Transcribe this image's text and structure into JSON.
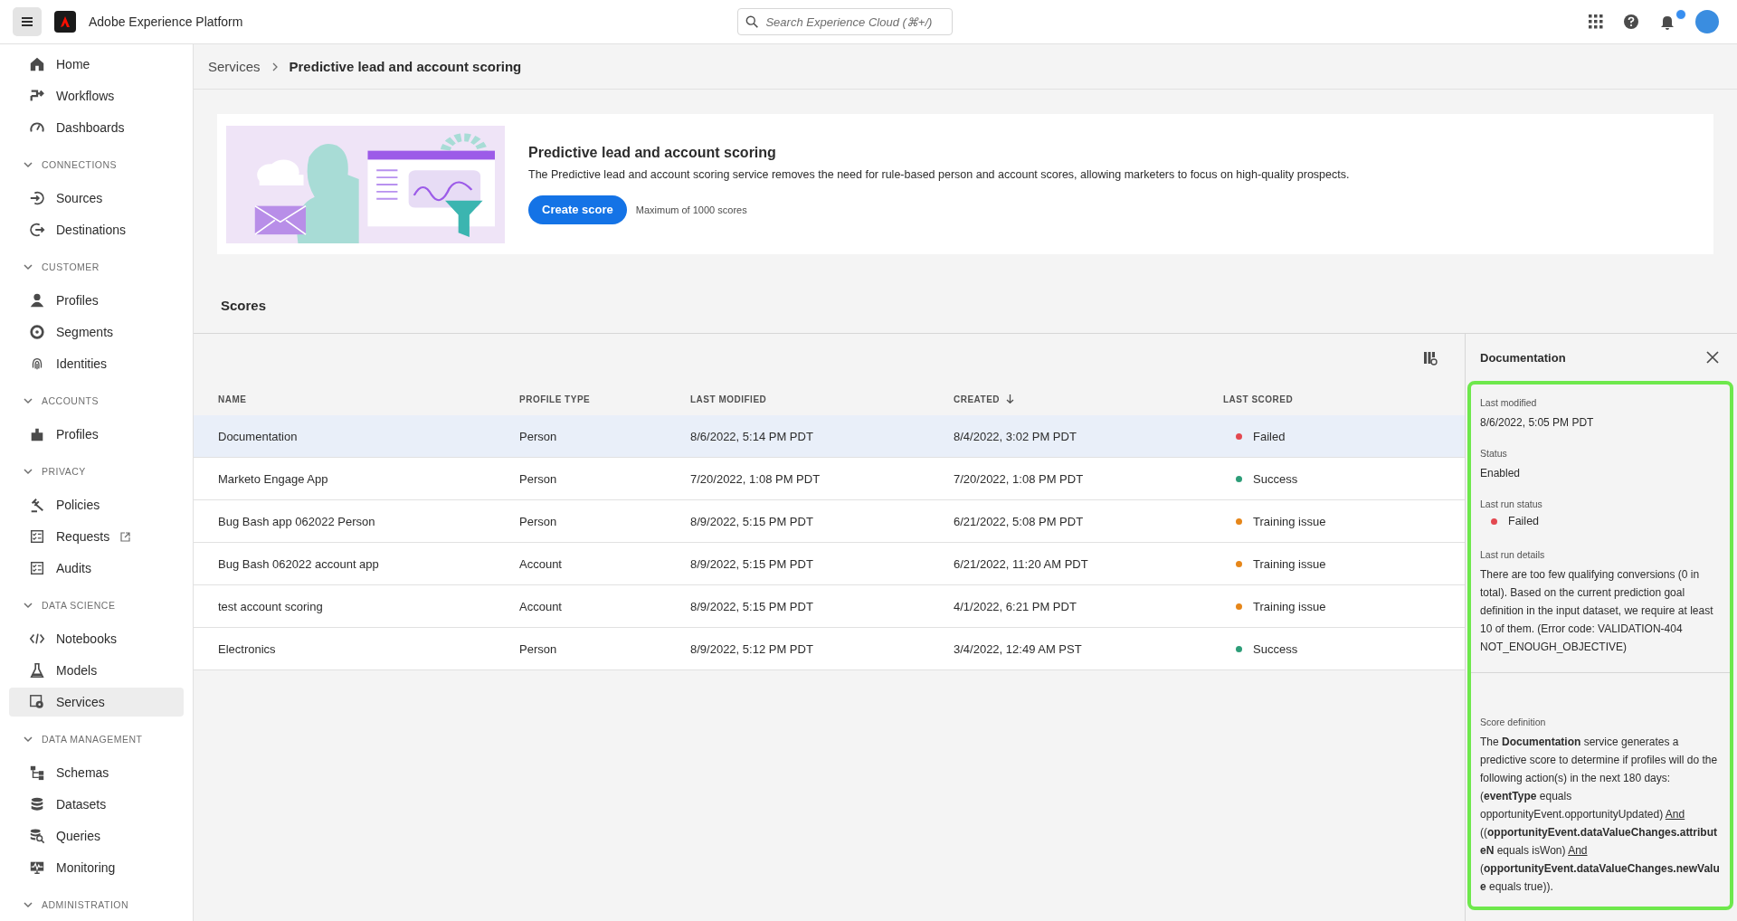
{
  "top_bar": {
    "product": "Adobe Experience Platform",
    "search": {
      "placeholder": "Search Experience Cloud (⌘+/)"
    },
    "notifications": {
      "unread": true
    }
  },
  "sidebar": {
    "items": [
      {
        "kind": "item",
        "label": "Home",
        "selected": false
      },
      {
        "kind": "item",
        "label": "Workflows",
        "selected": false
      },
      {
        "kind": "item",
        "label": "Dashboards",
        "selected": false
      },
      {
        "kind": "section",
        "label": "CONNECTIONS",
        "expanded": true
      },
      {
        "kind": "item",
        "label": "Sources",
        "selected": false
      },
      {
        "kind": "item",
        "label": "Destinations",
        "selected": false
      },
      {
        "kind": "section",
        "label": "CUSTOMER",
        "expanded": true
      },
      {
        "kind": "item",
        "label": "Profiles",
        "selected": false
      },
      {
        "kind": "item",
        "label": "Segments",
        "selected": false
      },
      {
        "kind": "item",
        "label": "Identities",
        "selected": false
      },
      {
        "kind": "section",
        "label": "ACCOUNTS",
        "expanded": true
      },
      {
        "kind": "item",
        "label": "Profiles",
        "selected": false
      },
      {
        "kind": "section",
        "label": "PRIVACY",
        "expanded": true
      },
      {
        "kind": "item",
        "label": "Policies",
        "selected": false
      },
      {
        "kind": "item",
        "label": "Requests",
        "selected": false,
        "external": true
      },
      {
        "kind": "item",
        "label": "Audits",
        "selected": false
      },
      {
        "kind": "section",
        "label": "DATA SCIENCE",
        "expanded": true
      },
      {
        "kind": "item",
        "label": "Notebooks",
        "selected": false
      },
      {
        "kind": "item",
        "label": "Models",
        "selected": false
      },
      {
        "kind": "item",
        "label": "Services",
        "selected": true
      },
      {
        "kind": "section",
        "label": "DATA MANAGEMENT",
        "expanded": true
      },
      {
        "kind": "item",
        "label": "Schemas",
        "selected": false
      },
      {
        "kind": "item",
        "label": "Datasets",
        "selected": false
      },
      {
        "kind": "item",
        "label": "Queries",
        "selected": false
      },
      {
        "kind": "item",
        "label": "Monitoring",
        "selected": false
      },
      {
        "kind": "section",
        "label": "ADMINISTRATION",
        "expanded": true
      }
    ]
  },
  "breadcrumb": [
    "Services",
    "Predictive lead and account scoring"
  ],
  "hero": {
    "title": "Predictive lead and account scoring",
    "description": "The Predictive lead and account scoring service removes the need for rule-based person and account scores, allowing marketers to focus on high-quality prospects.",
    "button": "Create score",
    "note": "Maximum of 1000 scores"
  },
  "scores": {
    "title": "Scores",
    "columns": [
      {
        "label": "NAME",
        "sorted": false
      },
      {
        "label": "PROFILE TYPE",
        "sorted": false
      },
      {
        "label": "LAST MODIFIED",
        "sorted": false
      },
      {
        "label": "CREATED",
        "sorted": true
      },
      {
        "label": "LAST SCORED",
        "sorted": false
      }
    ],
    "rows": [
      {
        "name": "Documentation",
        "profile_type": "Person",
        "last_modified": "8/6/2022, 5:14 PM PDT",
        "created": "8/4/2022, 3:02 PM PDT",
        "last_scored": "Failed",
        "color": "#e34850",
        "selected": true
      },
      {
        "name": "Marketo Engage App",
        "profile_type": "Person",
        "last_modified": "7/20/2022, 1:08 PM PDT",
        "created": "7/20/2022, 1:08 PM PDT",
        "last_scored": "Success",
        "color": "#2d9d78",
        "selected": false
      },
      {
        "name": "Bug Bash app 062022 Person",
        "profile_type": "Person",
        "last_modified": "8/9/2022, 5:15 PM PDT",
        "created": "6/21/2022, 5:08 PM PDT",
        "last_scored": "Training issue",
        "color": "#e68619",
        "selected": false
      },
      {
        "name": "Bug Bash 062022 account app",
        "profile_type": "Account",
        "last_modified": "8/9/2022, 5:15 PM PDT",
        "created": "6/21/2022, 11:20 AM PDT",
        "last_scored": "Training issue",
        "color": "#e68619",
        "selected": false
      },
      {
        "name": "test account scoring",
        "profile_type": "Account",
        "last_modified": "8/9/2022, 5:15 PM PDT",
        "created": "4/1/2022, 6:21 PM PDT",
        "last_scored": "Training issue",
        "color": "#e68619",
        "selected": false
      },
      {
        "name": "Electronics",
        "profile_type": "Person",
        "last_modified": "8/9/2022, 5:12 PM PDT",
        "created": "3/4/2022, 12:49 AM PST",
        "last_scored": "Success",
        "color": "#2d9d78",
        "selected": false
      }
    ]
  },
  "panel": {
    "title": "Documentation",
    "fields": [
      {
        "kind": "text",
        "label": "Last modified",
        "value": "8/6/2022, 5:05 PM PDT"
      },
      {
        "kind": "text",
        "label": "Status",
        "value": "Enabled"
      },
      {
        "kind": "status",
        "label": "Last run status",
        "value": "Failed",
        "color": "#e34850"
      },
      {
        "kind": "text",
        "label": "Last run details",
        "value": "There are too few qualifying conversions (0 in total). Based on the current prediction goal definition in the input dataset, we require at least 10 of them. (Error code: VALIDATION-404 NOT_ENOUGH_OBJECTIVE)"
      }
    ],
    "definition": {
      "label": "Score definition",
      "segments": [
        {
          "kind": "plain",
          "text": "The "
        },
        {
          "kind": "bold",
          "text": "Documentation"
        },
        {
          "kind": "plain",
          "text": " service generates a predictive score to determine if profiles will do the following action(s) in the next 180 days: ("
        },
        {
          "kind": "bold",
          "text": "eventType"
        },
        {
          "kind": "plain",
          "text": " equals opportunityEvent.opportunityUpdated) "
        },
        {
          "kind": "link",
          "text": "And"
        },
        {
          "kind": "plain",
          "text": " (("
        },
        {
          "kind": "bold",
          "text": "opportunityEvent.dataValueChanges.attributeN"
        },
        {
          "kind": "plain",
          "text": " equals isWon) "
        },
        {
          "kind": "link",
          "text": "And"
        },
        {
          "kind": "plain",
          "text": " ("
        },
        {
          "kind": "bold",
          "text": "opportunityEvent.dataValueChanges.newValue"
        },
        {
          "kind": "plain",
          "text": " equals true))."
        }
      ]
    }
  }
}
